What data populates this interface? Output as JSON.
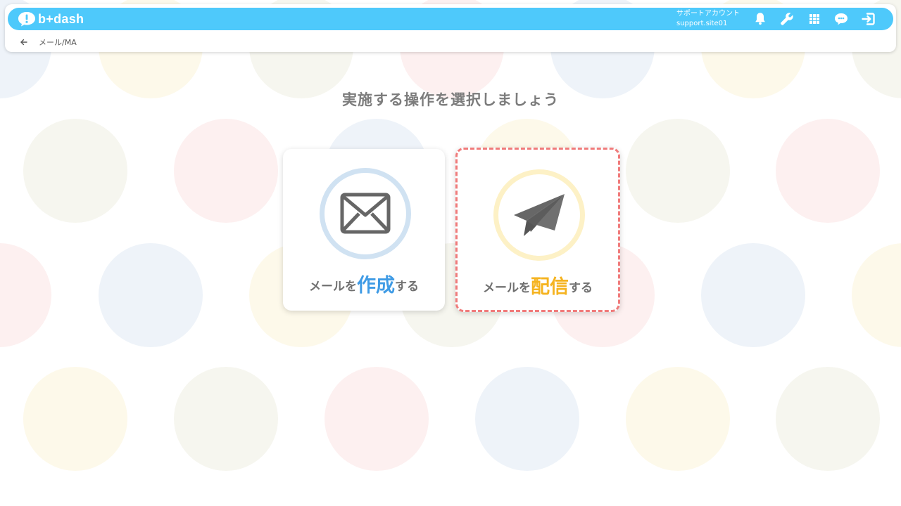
{
  "app": {
    "logo_text": "b+dash"
  },
  "account": {
    "name": "サポートアカウント",
    "site": "support.site01"
  },
  "icons": {
    "notifications": "bell-icon",
    "settings": "wrench-icon",
    "apps": "grid-icon",
    "support": "chat-bubble-icon",
    "logout": "logout-icon",
    "back": "back-arrow-icon"
  },
  "breadcrumb": {
    "label": "メール/MA"
  },
  "main": {
    "title": "実施する操作を選択しましょう",
    "cards": {
      "create": {
        "prefix": "メールを",
        "emphasis": "作成",
        "suffix": "する",
        "icon": "envelope-icon",
        "accent_color": "#3f9be5"
      },
      "deliver": {
        "prefix": "メールを",
        "emphasis": "配信",
        "suffix": "する",
        "icon": "paper-plane-icon",
        "accent_color": "#f5b31f"
      }
    }
  },
  "colors": {
    "topbar": "#4ec9fb",
    "selected_border": "#f07b7b"
  }
}
